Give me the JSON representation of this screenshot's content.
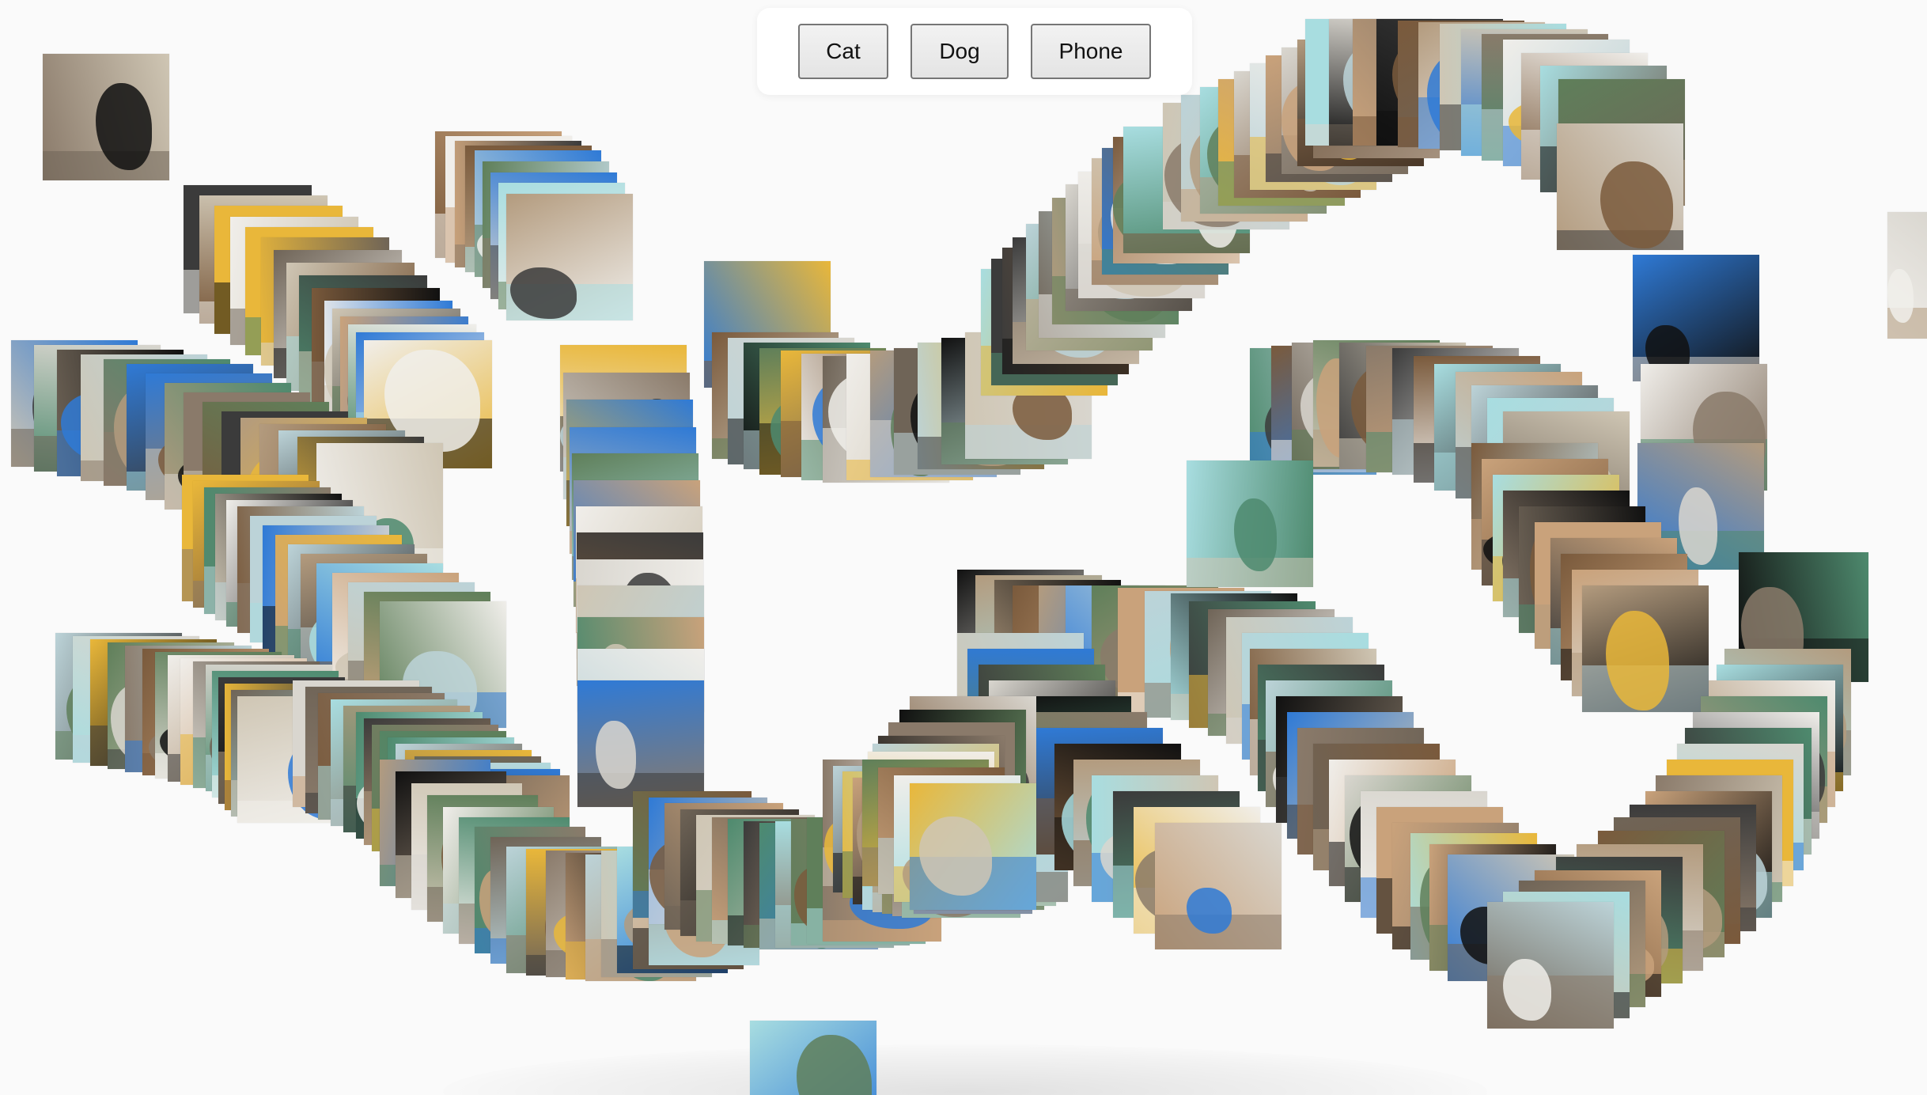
{
  "toolbar": {
    "buttons": [
      {
        "label": "Cat"
      },
      {
        "label": "Dog"
      },
      {
        "label": "Phone"
      }
    ]
  },
  "gallery": {
    "item_label": "photo-card",
    "palette": [
      "#8a7a6a",
      "#b39b7e",
      "#4e8a6e",
      "#2f7ad6",
      "#111111",
      "#e9b73a",
      "#a8dde0",
      "#d9d6cf",
      "#6f6457",
      "#c9a27b",
      "#3b3b3b",
      "#f0eeea",
      "#7a5a3c",
      "#bcd3d8",
      "#cfc6b4",
      "#5f7f5a"
    ]
  }
}
